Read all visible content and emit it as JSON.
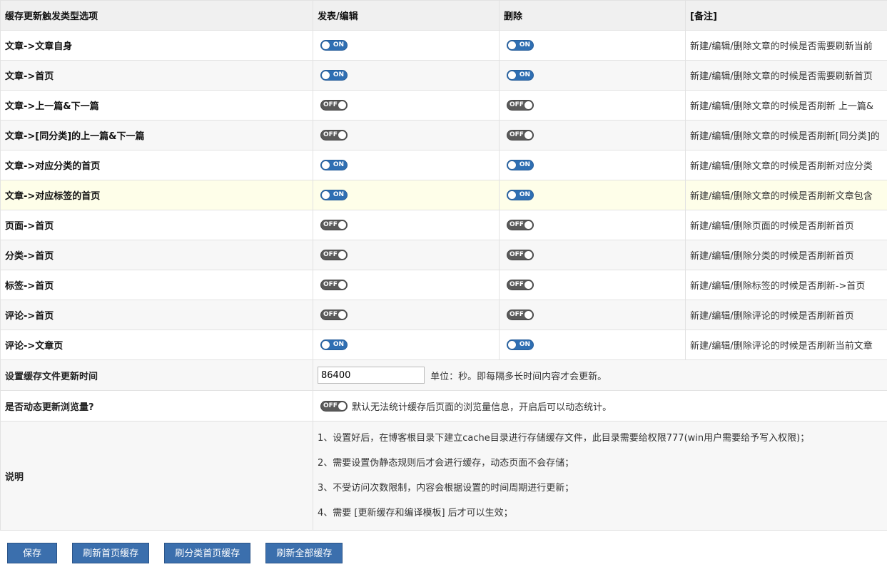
{
  "table": {
    "headers": [
      "缓存更新触发类型选项",
      "发表/编辑",
      "删除",
      "[备注]"
    ],
    "rows": [
      {
        "label": "文章->文章自身",
        "publish": "ON",
        "delete": "ON",
        "note": "新建/编辑/删除文章的时候是否需要刷新当前"
      },
      {
        "label": "文章->首页",
        "publish": "ON",
        "delete": "ON",
        "note": "新建/编辑/删除文章的时候是否需要刷新首页"
      },
      {
        "label": "文章->上一篇&下一篇",
        "publish": "OFF",
        "delete": "OFF",
        "note": "新建/编辑/删除文章的时候是否刷新 上一篇&"
      },
      {
        "label": "文章->[同分类]的上一篇&下一篇",
        "publish": "OFF",
        "delete": "OFF",
        "note": "新建/编辑/删除文章的时候是否刷新[同分类]的"
      },
      {
        "label": "文章->对应分类的首页",
        "publish": "ON",
        "delete": "ON",
        "note": "新建/编辑/删除文章的时候是否刷新对应分类"
      },
      {
        "label": "文章->对应标签的首页",
        "publish": "ON",
        "delete": "ON",
        "note": "新建/编辑/删除文章的时候是否刷新文章包含"
      },
      {
        "label": "页面->首页",
        "publish": "OFF",
        "delete": "OFF",
        "note": "新建/编辑/删除页面的时候是否刷新首页"
      },
      {
        "label": "分类->首页",
        "publish": "OFF",
        "delete": "OFF",
        "note": "新建/编辑/删除分类的时候是否刷新首页"
      },
      {
        "label": "标签->首页",
        "publish": "OFF",
        "delete": "OFF",
        "note": "新建/编辑/删除标签的时候是否刷新->首页"
      },
      {
        "label": "评论->首页",
        "publish": "OFF",
        "delete": "OFF",
        "note": "新建/编辑/删除评论的时候是否刷新首页"
      },
      {
        "label": "评论->文章页",
        "publish": "ON",
        "delete": "ON",
        "note": "新建/编辑/删除评论的时候是否刷新当前文章"
      }
    ]
  },
  "cache_time": {
    "label": "设置缓存文件更新时间",
    "value": "86400",
    "hint": "单位：秒。即每隔多长时间内容才会更新。"
  },
  "dynamic_views": {
    "label": "是否动态更新浏览量?",
    "state": "OFF",
    "hint": "默认无法统计缓存后页面的浏览量信息，开启后可以动态统计。"
  },
  "description": {
    "label": "说明",
    "lines": [
      "1、设置好后，在博客根目录下建立cache目录进行存储缓存文件，此目录需要给权限777(win用户需要给予写入权限)；",
      "2、需要设置伪静态规则后才会进行缓存，动态页面不会存储；",
      "3、不受访问次数限制，内容会根据设置的时间周期进行更新；",
      "4、需要 [更新缓存和编译模板] 后才可以生效；"
    ]
  },
  "buttons": {
    "save": "保存",
    "refresh_home": "刷新首页缓存",
    "refresh_category": "刷分类首页缓存",
    "refresh_all": "刷新全部缓存"
  },
  "colors": {
    "toggle_on": "#2f6fb3",
    "toggle_off": "#5a5a5a",
    "button": "#3b6fad",
    "highlight_row": "#fefee9"
  }
}
